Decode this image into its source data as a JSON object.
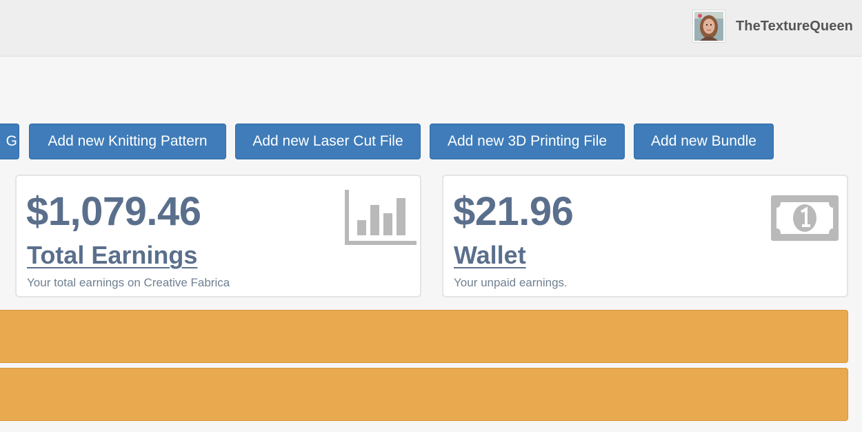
{
  "header": {
    "username": "TheTextureQueen"
  },
  "actions": {
    "clipped_label": "G",
    "knitting_label": "Add new Knitting Pattern",
    "laser_label": "Add new Laser Cut File",
    "printing_label": "Add new 3D Printing File",
    "bundle_label": "Add new Bundle"
  },
  "stats": {
    "earnings": {
      "amount": "$1,079.46",
      "title": "Total Earnings",
      "subtitle": "Your total earnings on Creative Fabrica",
      "icon": "bar-chart-icon"
    },
    "wallet": {
      "amount": "$21.96",
      "title": "Wallet",
      "subtitle": "Your unpaid earnings.",
      "icon": "money-icon"
    }
  },
  "colors": {
    "button": "#3f7cb9",
    "stat_text": "#5a6f8c",
    "alert": "#e9a94f"
  }
}
